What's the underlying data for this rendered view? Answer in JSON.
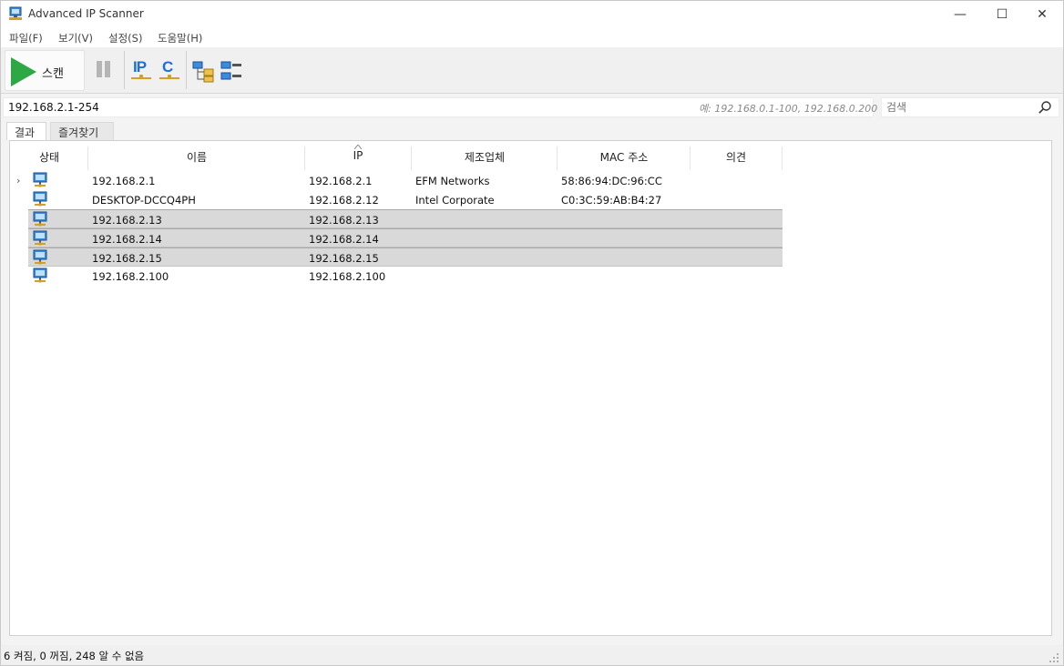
{
  "window": {
    "title": "Advanced IP Scanner",
    "min_glyph": "—",
    "max_glyph": "☐",
    "close_glyph": "✕"
  },
  "menu": [
    {
      "label": "파일(F)"
    },
    {
      "label": "보기(V)"
    },
    {
      "label": "설정(S)"
    },
    {
      "label": "도움말(H)"
    }
  ],
  "toolbar": {
    "scan_label": "스캔",
    "ip_label": "IP",
    "c_label": "C"
  },
  "address": {
    "range_value": "192.168.2.1-254",
    "range_hint": "예: 192.168.0.1-100, 192.168.0.200",
    "search_placeholder": "검색"
  },
  "tabs": [
    {
      "label": "결과"
    },
    {
      "label": "즐겨찾기"
    }
  ],
  "table": {
    "columns": [
      "상태",
      "이름",
      "IP",
      "제조업체",
      "MAC 주소",
      "의견"
    ],
    "rows": [
      {
        "name": "192.168.2.1",
        "ip": "192.168.2.1",
        "vendor": "EFM Networks",
        "mac": "58:86:94:DC:96:CC",
        "expand": "›",
        "selected": false
      },
      {
        "name": "DESKTOP-DCCQ4PH",
        "ip": "192.168.2.12",
        "vendor": "Intel Corporate",
        "mac": "C0:3C:59:AB:B4:27",
        "expand": "",
        "selected": false
      },
      {
        "name": "192.168.2.13",
        "ip": "192.168.2.13",
        "vendor": "",
        "mac": "",
        "expand": "",
        "selected": true
      },
      {
        "name": "192.168.2.14",
        "ip": "192.168.2.14",
        "vendor": "",
        "mac": "",
        "expand": "",
        "selected": true
      },
      {
        "name": "192.168.2.15",
        "ip": "192.168.2.15",
        "vendor": "",
        "mac": "",
        "expand": "",
        "selected": true
      },
      {
        "name": "192.168.2.100",
        "ip": "192.168.2.100",
        "vendor": "",
        "mac": "",
        "expand": "",
        "selected": false
      }
    ]
  },
  "status": {
    "text": "6 켜짐, 0 꺼짐, 248 알 수 없음"
  },
  "colors": {
    "accent_blue": "#1c6fd6",
    "scan_green": "#2ea745",
    "selection_gray": "#d9d9d9"
  },
  "icons": {
    "app": "network-computer-icon",
    "play": "play-icon",
    "pause": "pause-icon",
    "search": "search-icon",
    "host": "computer-icon"
  }
}
